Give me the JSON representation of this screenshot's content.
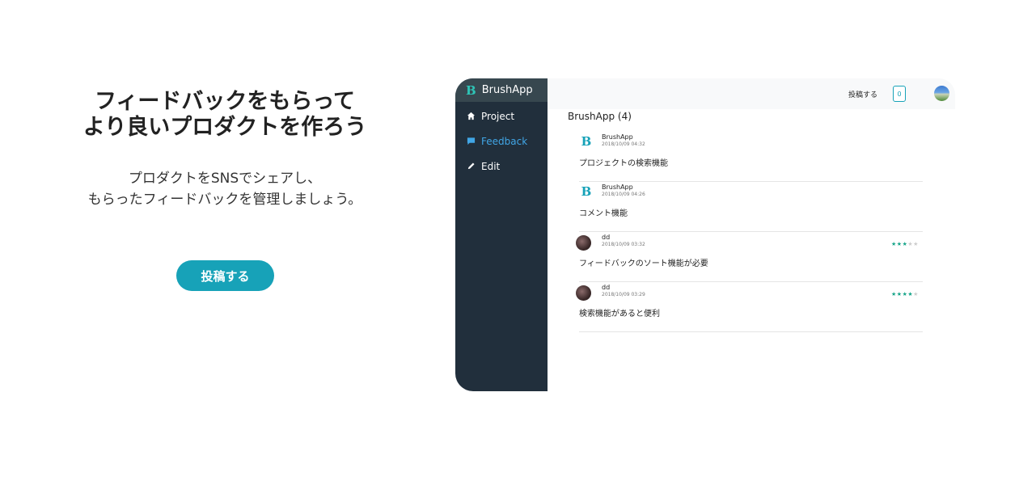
{
  "hero": {
    "title_lines": [
      "フィードバックをもらって",
      "より良いプロダクトを作ろう"
    ],
    "subtitle_lines": [
      "プロダクトをSNSでシェアし、",
      "もらったフィードバックを管理しましょう。"
    ],
    "cta_label": "投稿する"
  },
  "app": {
    "brand": {
      "logo": "B",
      "name": "BrushApp"
    },
    "nav": [
      {
        "label": "Project",
        "icon": "home-icon",
        "active": false
      },
      {
        "label": "Feedback",
        "icon": "comment-icon",
        "active": true
      },
      {
        "label": "Edit",
        "icon": "pencil-icon",
        "active": false
      }
    ],
    "topbar": {
      "post_label": "投稿する",
      "notification_count": "0"
    },
    "content_title": "BrushApp (4)",
    "feed": [
      {
        "author": "BrushApp",
        "date": "2018/10/09 04:32",
        "text": "プロジェクトの検索機能",
        "avatar": "brand-logo",
        "rating": null
      },
      {
        "author": "BrushApp",
        "date": "2018/10/09 04:26",
        "text": "コメント機能",
        "avatar": "brand-logo",
        "rating": null
      },
      {
        "author": "dd",
        "date": "2018/10/09 03:32",
        "text": "フィードバックのソート機能が必要",
        "avatar": "user-avatar",
        "rating": 3
      },
      {
        "author": "dd",
        "date": "2018/10/09 03:29",
        "text": "検索機能があると便利",
        "avatar": "user-avatar",
        "rating": 4
      }
    ],
    "rating_max": 5
  },
  "colors": {
    "accent": "#17a2b8",
    "sidebar_bg": "#212f3c",
    "brand_bg": "#37474f",
    "active_nav": "#41a6e6",
    "star_on": "#17a589"
  }
}
